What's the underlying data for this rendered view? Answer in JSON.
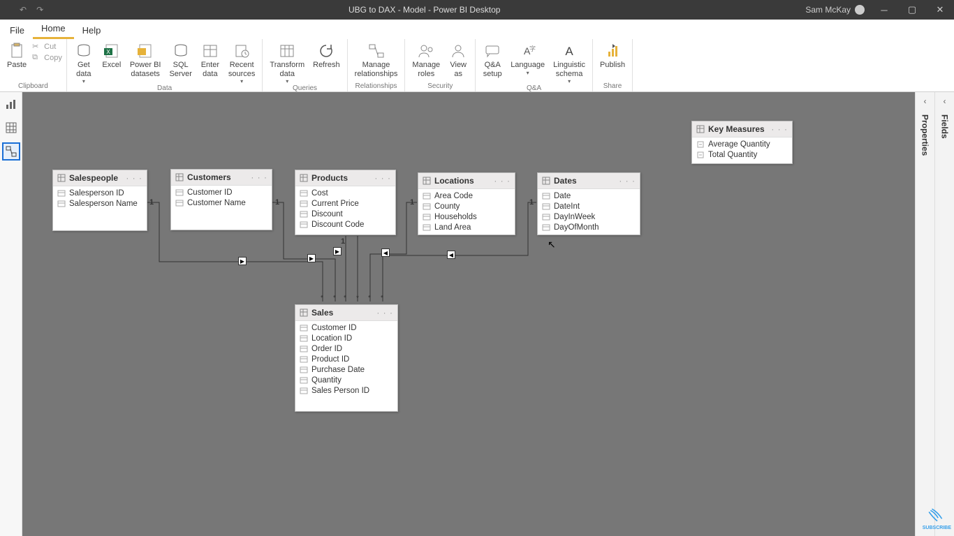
{
  "window": {
    "title": "UBG to DAX - Model - Power BI Desktop",
    "user": "Sam McKay"
  },
  "menu": {
    "file": "File",
    "home": "Home",
    "help": "Help"
  },
  "ribbon": {
    "clipboard": {
      "label": "Clipboard",
      "paste": "Paste",
      "cut": "Cut",
      "copy": "Copy"
    },
    "data": {
      "label": "Data",
      "getdata": "Get\ndata",
      "excel": "Excel",
      "pbids": "Power BI\ndatasets",
      "sqlserver": "SQL\nServer",
      "enterdata": "Enter\ndata",
      "recent": "Recent\nsources"
    },
    "queries": {
      "label": "Queries",
      "transform": "Transform\ndata",
      "refresh": "Refresh"
    },
    "relationships": {
      "label": "Relationships",
      "manage": "Manage\nrelationships"
    },
    "security": {
      "label": "Security",
      "roles": "Manage\nroles",
      "viewas": "View\nas"
    },
    "qa": {
      "label": "Q&A",
      "setup": "Q&A\nsetup",
      "language": "Language",
      "schema": "Linguistic\nschema"
    },
    "share": {
      "label": "Share",
      "publish": "Publish"
    }
  },
  "panes": {
    "properties": "Properties",
    "fields": "Fields"
  },
  "tables": {
    "salespeople": {
      "title": "Salespeople",
      "fields": [
        "Salesperson ID",
        "Salesperson Name"
      ]
    },
    "customers": {
      "title": "Customers",
      "fields": [
        "Customer ID",
        "Customer Name"
      ]
    },
    "products": {
      "title": "Products",
      "fields": [
        "Cost",
        "Current Price",
        "Discount",
        "Discount Code"
      ]
    },
    "locations": {
      "title": "Locations",
      "fields": [
        "Area Code",
        "County",
        "Households",
        "Land Area"
      ]
    },
    "dates": {
      "title": "Dates",
      "fields": [
        "Date",
        "DateInt",
        "DayInWeek",
        "DayOfMonth"
      ]
    },
    "sales": {
      "title": "Sales",
      "fields": [
        "Customer ID",
        "Location ID",
        "Order ID",
        "Product ID",
        "Purchase Date",
        "Quantity",
        "Sales Person ID"
      ]
    },
    "keymeasures": {
      "title": "Key Measures",
      "fields": [
        "Average Quantity",
        "Total Quantity"
      ]
    }
  },
  "subscribe": "SUBSCRIBE"
}
